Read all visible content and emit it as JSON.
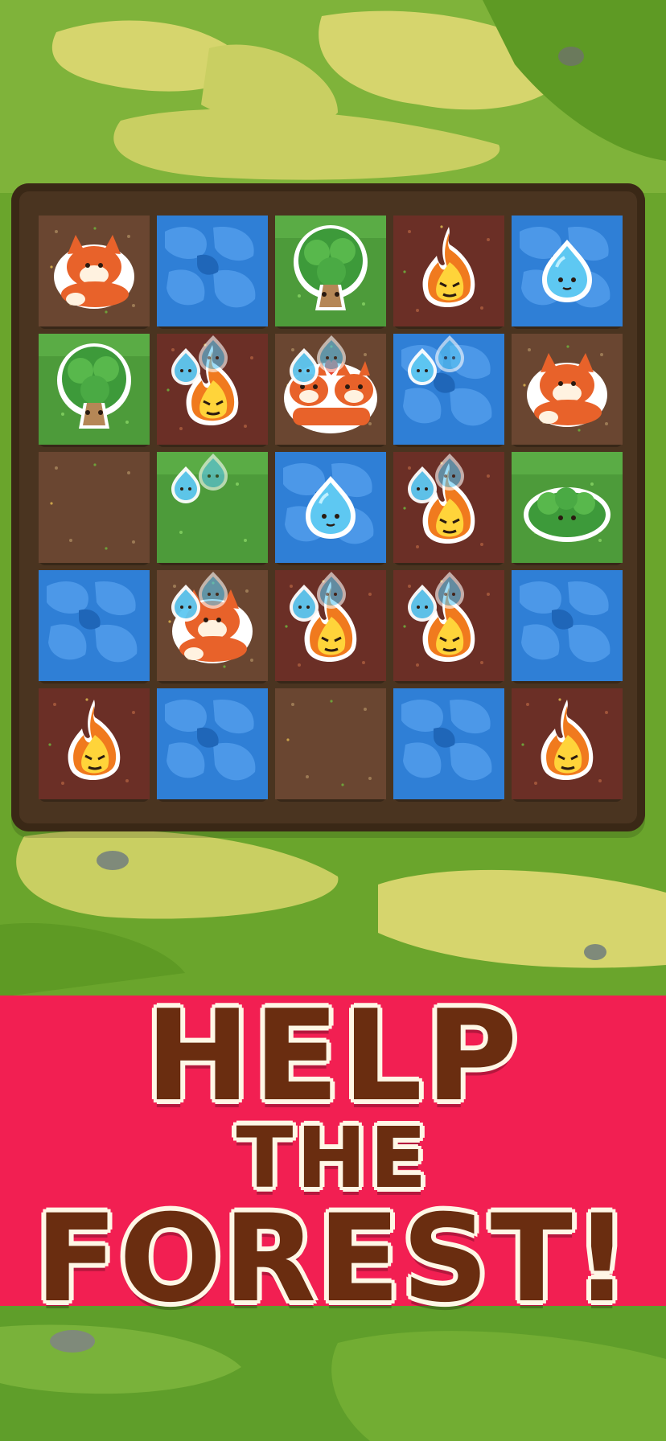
{
  "headline": {
    "line1": "HELP",
    "line2": "THE",
    "line3": "FOREST!"
  },
  "colors": {
    "banner": "#f21f52",
    "headline_text": "#6a2d10",
    "headline_outline": "#fff7e6",
    "grass_light": "#c9cf62",
    "grass_dark": "#5e9a24"
  },
  "board": {
    "rows": 5,
    "cols": 5,
    "tiles": [
      {
        "ground": "dirt",
        "piece": "fox-icon",
        "drops": 0
      },
      {
        "ground": "water",
        "piece": "",
        "drops": 0
      },
      {
        "ground": "grass",
        "piece": "tree-icon",
        "drops": 0
      },
      {
        "ground": "burnt",
        "piece": "fire-icon",
        "drops": 0
      },
      {
        "ground": "water",
        "piece": "droplet-icon",
        "drops": 0
      },
      {
        "ground": "grass",
        "piece": "tree-icon",
        "drops": 0
      },
      {
        "ground": "burnt",
        "piece": "fire-icon",
        "drops": 2
      },
      {
        "ground": "dirt",
        "piece": "fox-pair-icon",
        "drops": 2
      },
      {
        "ground": "water",
        "piece": "",
        "drops": 2
      },
      {
        "ground": "dirt",
        "piece": "fox-icon",
        "drops": 0
      },
      {
        "ground": "dirt",
        "piece": "",
        "drops": 0
      },
      {
        "ground": "grass",
        "piece": "",
        "drops": 2
      },
      {
        "ground": "water",
        "piece": "droplet-icon",
        "drops": 0
      },
      {
        "ground": "burnt",
        "piece": "fire-icon",
        "drops": 2
      },
      {
        "ground": "grass",
        "piece": "bush-icon",
        "drops": 0
      },
      {
        "ground": "water",
        "piece": "",
        "drops": 0
      },
      {
        "ground": "dirt",
        "piece": "fox-icon",
        "drops": 2
      },
      {
        "ground": "burnt",
        "piece": "fire-icon",
        "drops": 2
      },
      {
        "ground": "burnt",
        "piece": "fire-icon",
        "drops": 2
      },
      {
        "ground": "water",
        "piece": "",
        "drops": 0
      },
      {
        "ground": "burnt",
        "piece": "fire-icon",
        "drops": 0
      },
      {
        "ground": "water",
        "piece": "",
        "drops": 0
      },
      {
        "ground": "dirt",
        "piece": "",
        "drops": 0
      },
      {
        "ground": "water",
        "piece": "",
        "drops": 0
      },
      {
        "ground": "burnt",
        "piece": "fire-icon",
        "drops": 0
      }
    ]
  }
}
